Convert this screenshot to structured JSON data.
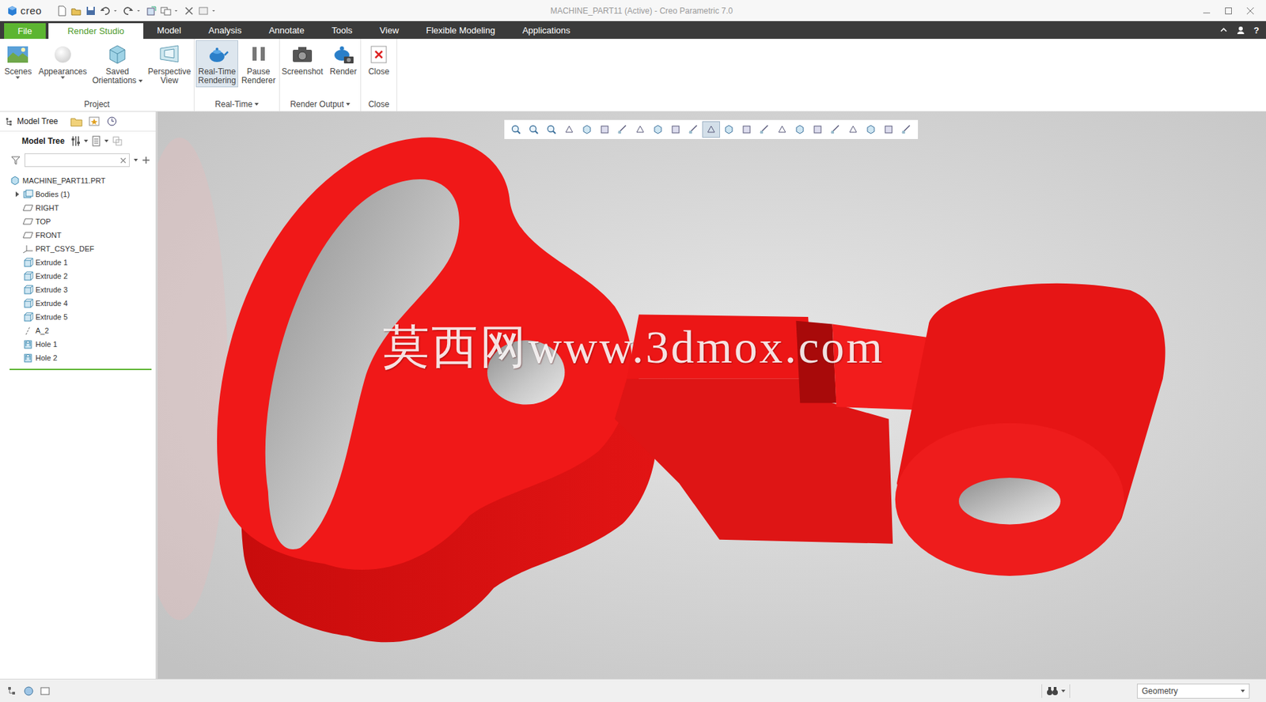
{
  "window": {
    "title": "MACHINE_PART11 (Active) - Creo Parametric 7.0",
    "logo": "creo"
  },
  "tabs": [
    {
      "label": "File",
      "selected": false,
      "kind": "file"
    },
    {
      "label": "Render Studio",
      "selected": true,
      "kind": "tab"
    },
    {
      "label": "Model",
      "selected": false,
      "kind": "tab"
    },
    {
      "label": "Analysis",
      "selected": false,
      "kind": "tab"
    },
    {
      "label": "Annotate",
      "selected": false,
      "kind": "tab"
    },
    {
      "label": "Tools",
      "selected": false,
      "kind": "tab"
    },
    {
      "label": "View",
      "selected": false,
      "kind": "tab"
    },
    {
      "label": "Flexible Modeling",
      "selected": false,
      "kind": "tab"
    },
    {
      "label": "Applications",
      "selected": false,
      "kind": "tab"
    }
  ],
  "help": "?",
  "ribbon": {
    "groups": [
      {
        "label": "Project",
        "dropdown": false,
        "buttons": [
          {
            "lines": [
              "Scenes"
            ],
            "kind": "scenes",
            "dropdown": "below",
            "selected": false
          },
          {
            "lines": [
              "Appearances"
            ],
            "kind": "appearances",
            "dropdown": "below",
            "selected": false
          },
          {
            "lines": [
              "Saved",
              "Orientations"
            ],
            "kind": "orientations",
            "dropdown": "inline",
            "selected": false
          },
          {
            "lines": [
              "Perspective",
              "View"
            ],
            "kind": "perspective",
            "dropdown": "none",
            "selected": false
          }
        ]
      },
      {
        "label": "Real-Time",
        "dropdown": true,
        "buttons": [
          {
            "lines": [
              "Real-Time",
              "Rendering"
            ],
            "kind": "realtime",
            "dropdown": "none",
            "selected": true
          },
          {
            "lines": [
              "Pause",
              "Renderer"
            ],
            "kind": "pause",
            "dropdown": "none",
            "selected": false
          }
        ]
      },
      {
        "label": "Render Output",
        "dropdown": true,
        "buttons": [
          {
            "lines": [
              "Screenshot"
            ],
            "kind": "screenshot",
            "dropdown": "none",
            "selected": false
          },
          {
            "lines": [
              "Render"
            ],
            "kind": "render",
            "dropdown": "none",
            "selected": false
          }
        ]
      },
      {
        "label": "Close",
        "dropdown": false,
        "buttons": [
          {
            "lines": [
              "Close"
            ],
            "kind": "close",
            "dropdown": "none",
            "selected": false
          }
        ]
      }
    ]
  },
  "model_tree": {
    "tab": "Model Tree",
    "toolbar_label": "Model Tree",
    "search": {
      "value": ""
    },
    "items": [
      {
        "label": "MACHINE_PART11.PRT",
        "kind": "part",
        "level": 0,
        "expandable": false,
        "expanded": false
      },
      {
        "label": "Bodies (1)",
        "kind": "bodies",
        "level": 1,
        "expandable": true,
        "expanded": false
      },
      {
        "label": "RIGHT",
        "kind": "plane",
        "level": 1,
        "expandable": false,
        "expanded": false
      },
      {
        "label": "TOP",
        "kind": "plane",
        "level": 1,
        "expandable": false,
        "expanded": false
      },
      {
        "label": "FRONT",
        "kind": "plane",
        "level": 1,
        "expandable": false,
        "expanded": false
      },
      {
        "label": "PRT_CSYS_DEF",
        "kind": "csys",
        "level": 1,
        "expandable": false,
        "expanded": false
      },
      {
        "label": "Extrude 1",
        "kind": "extrude",
        "level": 1,
        "expandable": false,
        "expanded": false
      },
      {
        "label": "Extrude 2",
        "kind": "extrude",
        "level": 1,
        "expandable": false,
        "expanded": false
      },
      {
        "label": "Extrude 3",
        "kind": "extrude",
        "level": 1,
        "expandable": false,
        "expanded": false
      },
      {
        "label": "Extrude 4",
        "kind": "extrude",
        "level": 1,
        "expandable": false,
        "expanded": false
      },
      {
        "label": "Extrude 5",
        "kind": "extrude",
        "level": 1,
        "expandable": false,
        "expanded": false
      },
      {
        "label": "A_2",
        "kind": "axis",
        "level": 1,
        "expandable": false,
        "expanded": false
      },
      {
        "label": "Hole 1",
        "kind": "hole",
        "level": 1,
        "expandable": false,
        "expanded": false
      },
      {
        "label": "Hole 2",
        "kind": "hole",
        "level": 1,
        "expandable": false,
        "expanded": false
      }
    ]
  },
  "view_toolbar": [
    {
      "selected": false
    },
    {
      "selected": false
    },
    {
      "selected": false
    },
    {
      "selected": false
    },
    {
      "selected": false
    },
    {
      "selected": false
    },
    {
      "selected": false
    },
    {
      "selected": false
    },
    {
      "selected": false
    },
    {
      "selected": false
    },
    {
      "selected": false
    },
    {
      "selected": true
    },
    {
      "selected": false
    },
    {
      "selected": false
    },
    {
      "selected": false
    },
    {
      "selected": false
    },
    {
      "selected": false
    },
    {
      "selected": false
    },
    {
      "selected": false
    },
    {
      "selected": false
    },
    {
      "selected": false
    },
    {
      "selected": false
    },
    {
      "selected": false
    }
  ],
  "viewport": {
    "watermark": "莫西网www.3dmox.com"
  },
  "status_bar": {
    "filter": "Geometry"
  }
}
